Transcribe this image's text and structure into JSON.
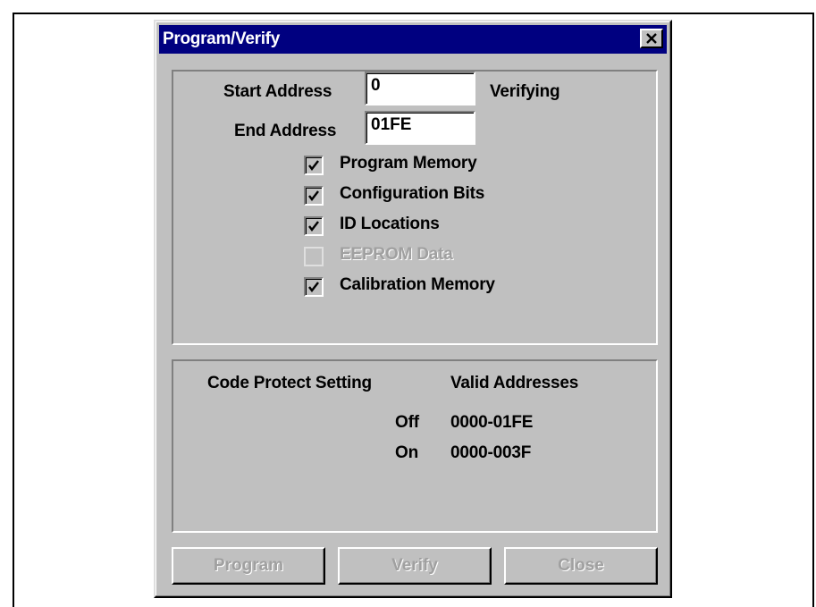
{
  "window": {
    "title": "Program/Verify",
    "close_icon": "close-x-icon"
  },
  "address": {
    "start_label": "Start Address",
    "start_value": "0",
    "end_label": "End Address",
    "end_value": "01FE",
    "status": "Verifying"
  },
  "options": [
    {
      "label": "Program Memory",
      "checked": true,
      "enabled": true
    },
    {
      "label": "Configuration Bits",
      "checked": true,
      "enabled": true
    },
    {
      "label": "ID Locations",
      "checked": true,
      "enabled": true
    },
    {
      "label": "EEPROM Data",
      "checked": false,
      "enabled": false
    },
    {
      "label": "Calibration Memory",
      "checked": true,
      "enabled": true
    }
  ],
  "code_protect": {
    "header_setting": "Code Protect Setting",
    "header_addresses": "Valid Addresses",
    "rows": [
      {
        "setting": "Off",
        "addresses": "0000-01FE"
      },
      {
        "setting": "On",
        "addresses": "0000-003F"
      }
    ]
  },
  "buttons": {
    "program": "Program",
    "verify": "Verify",
    "close": "Close"
  }
}
